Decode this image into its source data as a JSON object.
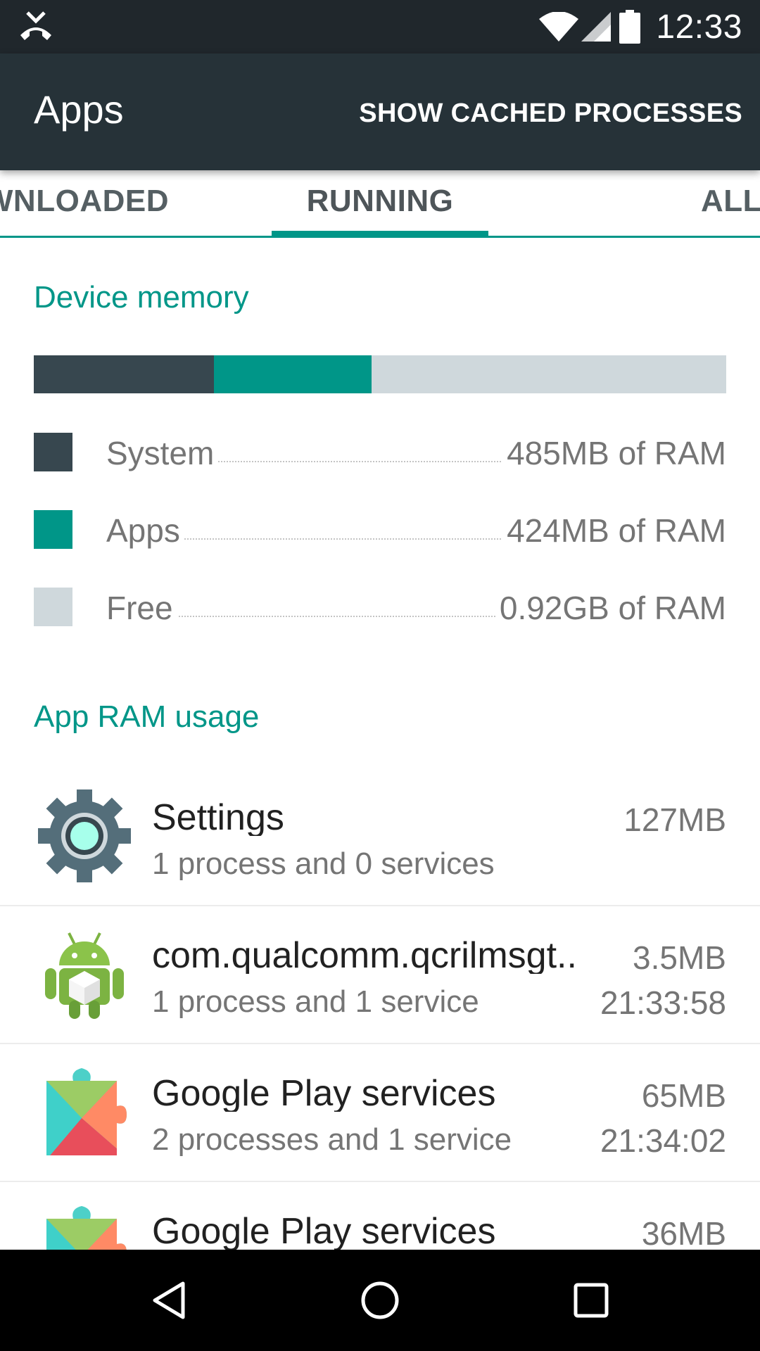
{
  "status_bar": {
    "time": "12:33",
    "icons": [
      "missed-call-icon",
      "wifi-icon",
      "signal-icon",
      "battery-icon"
    ]
  },
  "app_bar": {
    "title": "Apps",
    "action_label": "SHOW CACHED PROCESSES"
  },
  "tabs": [
    {
      "label": "DOWNLOADED",
      "visible_text": "WNLOADED",
      "selected": false
    },
    {
      "label": "RUNNING",
      "selected": true
    },
    {
      "label": "ALL",
      "selected": false
    }
  ],
  "device_memory": {
    "header": "Device memory",
    "bar_fractions": {
      "system": 0.26,
      "apps": 0.228,
      "free": 0.512
    },
    "legend": [
      {
        "label": "System",
        "value": "485MB of RAM",
        "color": "#37474f"
      },
      {
        "label": "Apps",
        "value": "424MB of RAM",
        "color": "#009688"
      },
      {
        "label": "Free",
        "value": "0.92GB of RAM",
        "color": "#cfd8dc"
      }
    ]
  },
  "app_ram": {
    "header": "App RAM usage",
    "items": [
      {
        "name": "Settings",
        "size": "127MB",
        "detail": "1 process and 0 services",
        "time": "",
        "icon": "settings-gear-icon"
      },
      {
        "name": "com.qualcomm.qcrilmsgt..",
        "size": "3.5MB",
        "detail": "1 process and 1 service",
        "time": "21:33:58",
        "icon": "android-robot-icon"
      },
      {
        "name": "Google Play services",
        "size": "65MB",
        "detail": "2 processes and 1 service",
        "time": "21:34:02",
        "icon": "google-play-services-icon"
      },
      {
        "name": "Google Play services",
        "size": "36MB",
        "detail": "",
        "time": "",
        "icon": "google-play-services-icon"
      }
    ]
  },
  "nav_bar": {
    "buttons": [
      "back-icon",
      "home-icon",
      "recents-icon"
    ]
  },
  "colors": {
    "accent": "#009688",
    "app_bar": "#263238",
    "status_bar": "#20272c",
    "system": "#37474f",
    "free": "#cfd8dc"
  }
}
